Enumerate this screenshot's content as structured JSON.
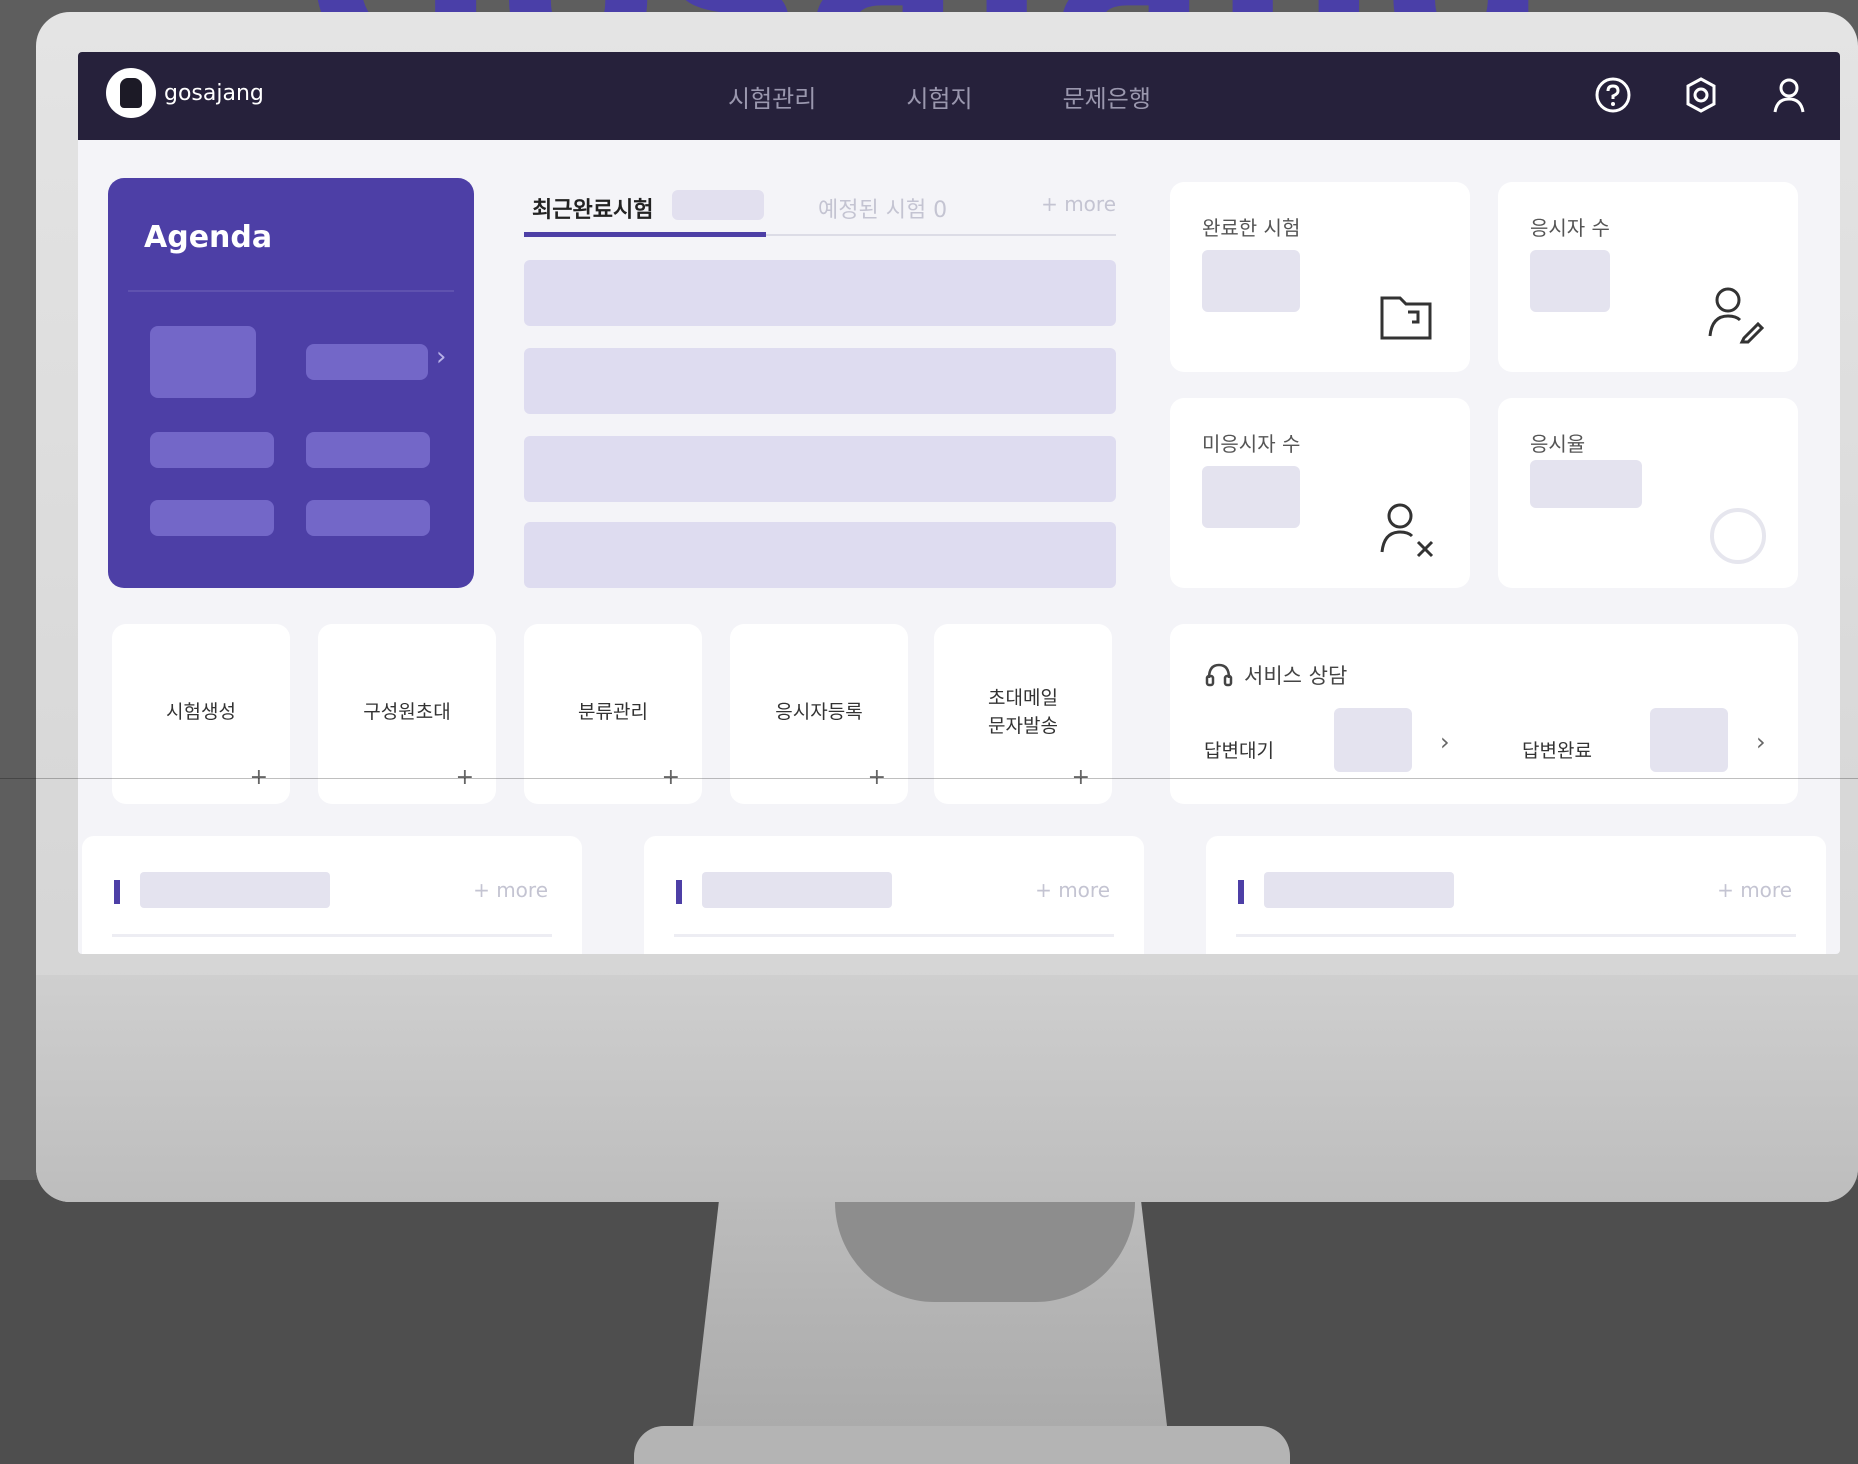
{
  "brand": {
    "watermark": "Gosajang"
  },
  "topbar": {
    "logo_text": "gosajang",
    "nav": [
      "시험관리",
      "시험지",
      "문제은행"
    ],
    "icons": [
      "help-icon",
      "settings-gear-icon",
      "user-icon"
    ]
  },
  "agenda": {
    "title": "Agenda"
  },
  "exam_list": {
    "tab_active": "최근완료시험",
    "tab_inactive": "예정된 시험 0",
    "more": "+ more"
  },
  "stats": [
    {
      "label": "완료한 시험",
      "icon": "folder-icon"
    },
    {
      "label": "응시자 수",
      "icon": "user-edit-icon"
    },
    {
      "label": "미응시자 수",
      "icon": "user-remove-icon"
    },
    {
      "label": "응시율",
      "icon": "progress-ring-icon"
    }
  ],
  "quick_actions": [
    {
      "label": "시험생성",
      "plus": "+"
    },
    {
      "label": "구성원초대",
      "plus": "+"
    },
    {
      "label": "분류관리",
      "plus": "+"
    },
    {
      "label": "응시자등록",
      "plus": "+"
    },
    {
      "label": "초대메일\n문자발송",
      "plus": "+"
    }
  ],
  "support": {
    "title": "서비스 상담",
    "pending_label": "답변대기",
    "done_label": "답변완료",
    "chevron": "›"
  },
  "bottom_panels": [
    {
      "more": "+ more"
    },
    {
      "more": "+ more"
    },
    {
      "more": "+ more"
    }
  ],
  "colors": {
    "accent": "#4d3fa6",
    "topbar": "#26213b",
    "placeholder": "#e4e3ef"
  }
}
